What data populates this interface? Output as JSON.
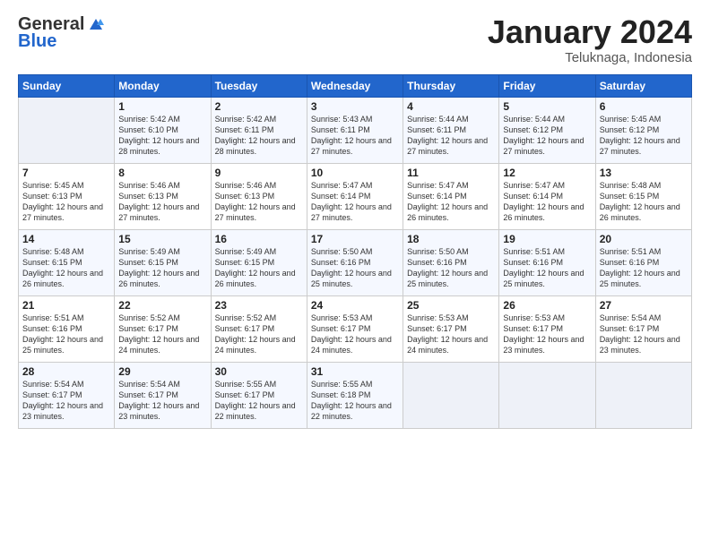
{
  "logo": {
    "general": "General",
    "blue": "Blue"
  },
  "header": {
    "month": "January 2024",
    "location": "Teluknaga, Indonesia"
  },
  "days_of_week": [
    "Sunday",
    "Monday",
    "Tuesday",
    "Wednesday",
    "Thursday",
    "Friday",
    "Saturday"
  ],
  "weeks": [
    [
      {
        "day": "",
        "sunrise": "",
        "sunset": "",
        "daylight": ""
      },
      {
        "day": "1",
        "sunrise": "Sunrise: 5:42 AM",
        "sunset": "Sunset: 6:10 PM",
        "daylight": "Daylight: 12 hours and 28 minutes."
      },
      {
        "day": "2",
        "sunrise": "Sunrise: 5:42 AM",
        "sunset": "Sunset: 6:11 PM",
        "daylight": "Daylight: 12 hours and 28 minutes."
      },
      {
        "day": "3",
        "sunrise": "Sunrise: 5:43 AM",
        "sunset": "Sunset: 6:11 PM",
        "daylight": "Daylight: 12 hours and 27 minutes."
      },
      {
        "day": "4",
        "sunrise": "Sunrise: 5:44 AM",
        "sunset": "Sunset: 6:11 PM",
        "daylight": "Daylight: 12 hours and 27 minutes."
      },
      {
        "day": "5",
        "sunrise": "Sunrise: 5:44 AM",
        "sunset": "Sunset: 6:12 PM",
        "daylight": "Daylight: 12 hours and 27 minutes."
      },
      {
        "day": "6",
        "sunrise": "Sunrise: 5:45 AM",
        "sunset": "Sunset: 6:12 PM",
        "daylight": "Daylight: 12 hours and 27 minutes."
      }
    ],
    [
      {
        "day": "7",
        "sunrise": "Sunrise: 5:45 AM",
        "sunset": "Sunset: 6:13 PM",
        "daylight": "Daylight: 12 hours and 27 minutes."
      },
      {
        "day": "8",
        "sunrise": "Sunrise: 5:46 AM",
        "sunset": "Sunset: 6:13 PM",
        "daylight": "Daylight: 12 hours and 27 minutes."
      },
      {
        "day": "9",
        "sunrise": "Sunrise: 5:46 AM",
        "sunset": "Sunset: 6:13 PM",
        "daylight": "Daylight: 12 hours and 27 minutes."
      },
      {
        "day": "10",
        "sunrise": "Sunrise: 5:47 AM",
        "sunset": "Sunset: 6:14 PM",
        "daylight": "Daylight: 12 hours and 27 minutes."
      },
      {
        "day": "11",
        "sunrise": "Sunrise: 5:47 AM",
        "sunset": "Sunset: 6:14 PM",
        "daylight": "Daylight: 12 hours and 26 minutes."
      },
      {
        "day": "12",
        "sunrise": "Sunrise: 5:47 AM",
        "sunset": "Sunset: 6:14 PM",
        "daylight": "Daylight: 12 hours and 26 minutes."
      },
      {
        "day": "13",
        "sunrise": "Sunrise: 5:48 AM",
        "sunset": "Sunset: 6:15 PM",
        "daylight": "Daylight: 12 hours and 26 minutes."
      }
    ],
    [
      {
        "day": "14",
        "sunrise": "Sunrise: 5:48 AM",
        "sunset": "Sunset: 6:15 PM",
        "daylight": "Daylight: 12 hours and 26 minutes."
      },
      {
        "day": "15",
        "sunrise": "Sunrise: 5:49 AM",
        "sunset": "Sunset: 6:15 PM",
        "daylight": "Daylight: 12 hours and 26 minutes."
      },
      {
        "day": "16",
        "sunrise": "Sunrise: 5:49 AM",
        "sunset": "Sunset: 6:15 PM",
        "daylight": "Daylight: 12 hours and 26 minutes."
      },
      {
        "day": "17",
        "sunrise": "Sunrise: 5:50 AM",
        "sunset": "Sunset: 6:16 PM",
        "daylight": "Daylight: 12 hours and 25 minutes."
      },
      {
        "day": "18",
        "sunrise": "Sunrise: 5:50 AM",
        "sunset": "Sunset: 6:16 PM",
        "daylight": "Daylight: 12 hours and 25 minutes."
      },
      {
        "day": "19",
        "sunrise": "Sunrise: 5:51 AM",
        "sunset": "Sunset: 6:16 PM",
        "daylight": "Daylight: 12 hours and 25 minutes."
      },
      {
        "day": "20",
        "sunrise": "Sunrise: 5:51 AM",
        "sunset": "Sunset: 6:16 PM",
        "daylight": "Daylight: 12 hours and 25 minutes."
      }
    ],
    [
      {
        "day": "21",
        "sunrise": "Sunrise: 5:51 AM",
        "sunset": "Sunset: 6:16 PM",
        "daylight": "Daylight: 12 hours and 25 minutes."
      },
      {
        "day": "22",
        "sunrise": "Sunrise: 5:52 AM",
        "sunset": "Sunset: 6:17 PM",
        "daylight": "Daylight: 12 hours and 24 minutes."
      },
      {
        "day": "23",
        "sunrise": "Sunrise: 5:52 AM",
        "sunset": "Sunset: 6:17 PM",
        "daylight": "Daylight: 12 hours and 24 minutes."
      },
      {
        "day": "24",
        "sunrise": "Sunrise: 5:53 AM",
        "sunset": "Sunset: 6:17 PM",
        "daylight": "Daylight: 12 hours and 24 minutes."
      },
      {
        "day": "25",
        "sunrise": "Sunrise: 5:53 AM",
        "sunset": "Sunset: 6:17 PM",
        "daylight": "Daylight: 12 hours and 24 minutes."
      },
      {
        "day": "26",
        "sunrise": "Sunrise: 5:53 AM",
        "sunset": "Sunset: 6:17 PM",
        "daylight": "Daylight: 12 hours and 23 minutes."
      },
      {
        "day": "27",
        "sunrise": "Sunrise: 5:54 AM",
        "sunset": "Sunset: 6:17 PM",
        "daylight": "Daylight: 12 hours and 23 minutes."
      }
    ],
    [
      {
        "day": "28",
        "sunrise": "Sunrise: 5:54 AM",
        "sunset": "Sunset: 6:17 PM",
        "daylight": "Daylight: 12 hours and 23 minutes."
      },
      {
        "day": "29",
        "sunrise": "Sunrise: 5:54 AM",
        "sunset": "Sunset: 6:17 PM",
        "daylight": "Daylight: 12 hours and 23 minutes."
      },
      {
        "day": "30",
        "sunrise": "Sunrise: 5:55 AM",
        "sunset": "Sunset: 6:17 PM",
        "daylight": "Daylight: 12 hours and 22 minutes."
      },
      {
        "day": "31",
        "sunrise": "Sunrise: 5:55 AM",
        "sunset": "Sunset: 6:18 PM",
        "daylight": "Daylight: 12 hours and 22 minutes."
      },
      {
        "day": "",
        "sunrise": "",
        "sunset": "",
        "daylight": ""
      },
      {
        "day": "",
        "sunrise": "",
        "sunset": "",
        "daylight": ""
      },
      {
        "day": "",
        "sunrise": "",
        "sunset": "",
        "daylight": ""
      }
    ]
  ]
}
